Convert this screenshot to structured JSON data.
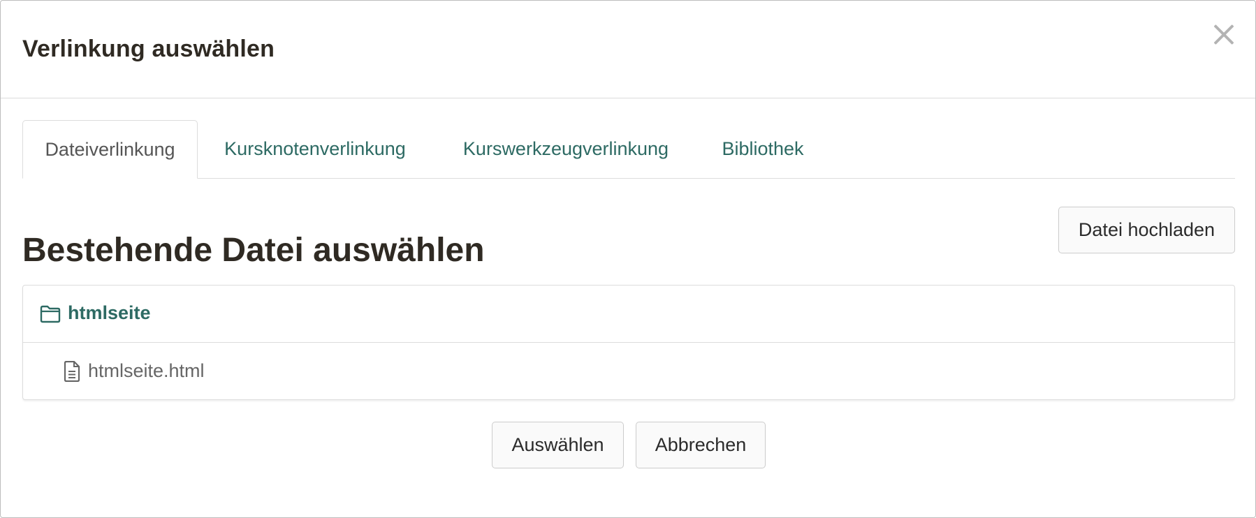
{
  "dialog": {
    "title": "Verlinkung auswählen"
  },
  "tabs": [
    {
      "label": "Dateiverlinkung",
      "active": true
    },
    {
      "label": "Kursknotenverlinkung",
      "active": false
    },
    {
      "label": "Kurswerkzeugverlinkung",
      "active": false
    },
    {
      "label": "Bibliothek",
      "active": false
    }
  ],
  "main": {
    "upload_button": "Datei hochladen",
    "section_title": "Bestehende Datei auswählen",
    "tree": {
      "folder": {
        "label": "htmlseite",
        "icon": "folder-icon"
      },
      "file": {
        "label": "htmlseite.html",
        "icon": "file-text-icon"
      }
    }
  },
  "footer": {
    "select_button": "Auswählen",
    "cancel_button": "Abbrechen"
  },
  "colors": {
    "accent": "#2d6a63",
    "title": "#2f2a23",
    "border": "#dcdcdc"
  }
}
